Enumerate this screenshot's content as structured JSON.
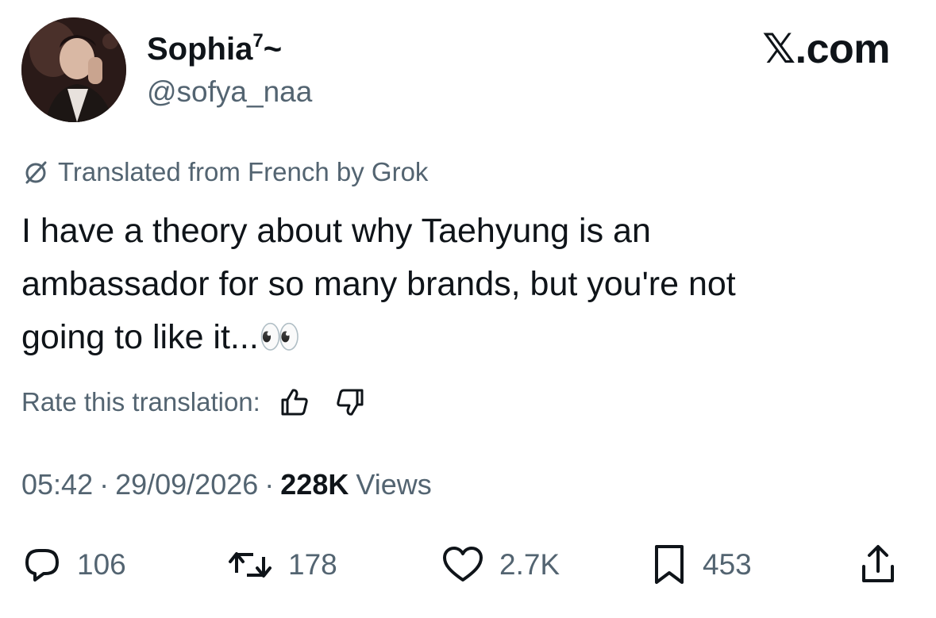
{
  "author": {
    "display_name": "Sophia",
    "display_name_superscript": "7",
    "display_name_suffix": "~",
    "handle": "@sofya_naa"
  },
  "brand": {
    "text": ".com",
    "x_glyph": "𝕏"
  },
  "translation": {
    "label": "Translated from French by Grok",
    "icon": "grok-slash-circle-icon"
  },
  "tweet": {
    "lines": [
      "I have a theory about why Taehyung is an",
      "ambassador for so many brands, but you're not",
      "going to like it...👀"
    ]
  },
  "rate": {
    "label": "Rate this translation:",
    "up_icon": "thumbs-up-icon",
    "down_icon": "thumbs-down-icon"
  },
  "meta": {
    "time": "05:42",
    "separator": "·",
    "date": "29/09/2026",
    "views_count": "228K",
    "views_label": "Views"
  },
  "actions": {
    "replies": "106",
    "reposts": "178",
    "likes": "2.7K",
    "bookmarks": "453"
  },
  "colors": {
    "text_primary": "#0f1419",
    "text_secondary": "#536471",
    "background": "#ffffff"
  }
}
